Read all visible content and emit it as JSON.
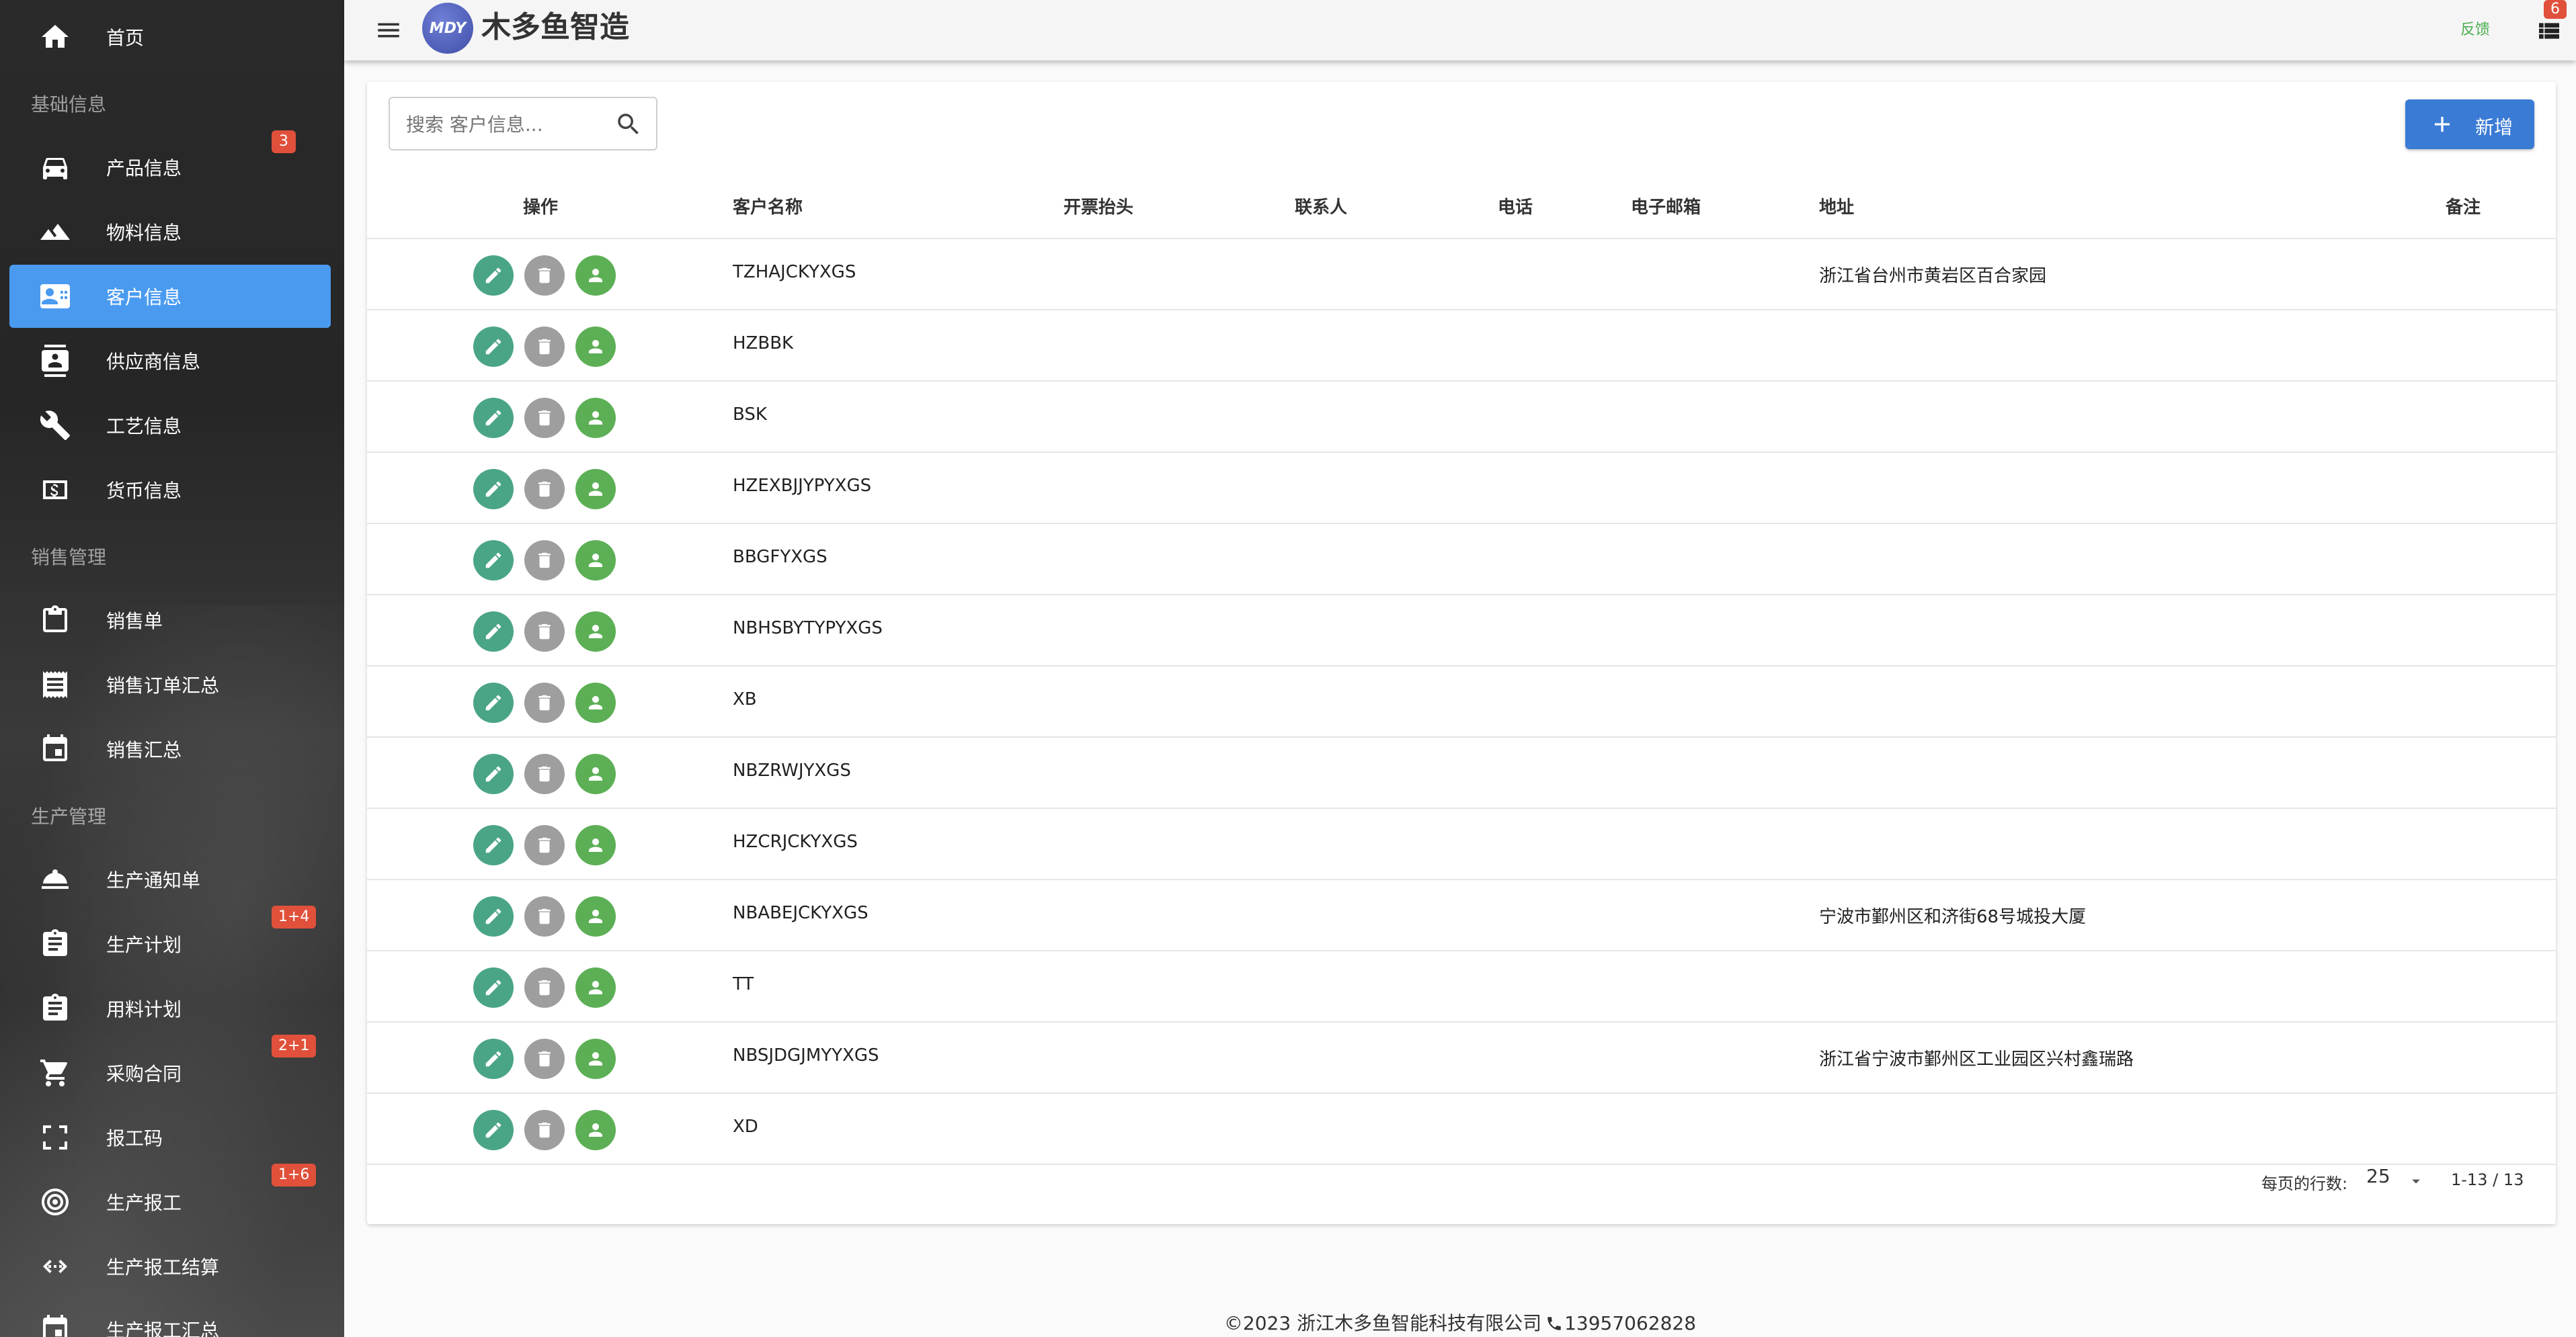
{
  "app": {
    "brand": "木多鱼智造",
    "logo_text": "MDY"
  },
  "header": {
    "feedback_label": "反馈",
    "notifications_count": "6"
  },
  "sidebar": {
    "home": "首页",
    "sections": {
      "basic": "基础信息",
      "sales": "销售管理",
      "production": "生产管理"
    },
    "items": {
      "product": "产品信息",
      "material": "物料信息",
      "customer": "客户信息",
      "supplier": "供应商信息",
      "process": "工艺信息",
      "currency": "货币信息",
      "sales_order": "销售单",
      "sales_order_summary": "销售订单汇总",
      "sales_summary": "销售汇总",
      "production_notice": "生产通知单",
      "production_plan": "生产计划",
      "material_plan": "用料计划",
      "purchase_contract": "采购合同",
      "work_code": "报工码",
      "production_report": "生产报工",
      "report_settlement": "生产报工结算",
      "report_summary": "生产报工汇总"
    },
    "badges": {
      "product": "3",
      "production_plan": "1+4",
      "purchase_contract": "2+1",
      "production_report": "1+6"
    }
  },
  "toolbar": {
    "search_placeholder": "搜索 客户信息...",
    "add_label": "新增"
  },
  "table": {
    "columns": {
      "actions": "操作",
      "name": "客户名称",
      "invoice": "开票抬头",
      "contact": "联系人",
      "phone": "电话",
      "email": "电子邮箱",
      "address": "地址",
      "remark": "备注"
    },
    "rows": [
      {
        "name": "TZHAJCKYXGS",
        "address": "浙江省台州市黄岩区百合家园"
      },
      {
        "name": "HZBBK",
        "address": ""
      },
      {
        "name": "BSK",
        "address": ""
      },
      {
        "name": "HZEXBJJYPYXGS",
        "address": ""
      },
      {
        "name": "BBGFYXGS",
        "address": ""
      },
      {
        "name": "NBHSBYTYPYXGS",
        "address": ""
      },
      {
        "name": "XB",
        "address": ""
      },
      {
        "name": "NBZRWJYXGS",
        "address": ""
      },
      {
        "name": "HZCRJCKYXGS",
        "address": ""
      },
      {
        "name": "NBABEJCKYXGS",
        "address": "宁波市鄞州区和济街68号城投大厦"
      },
      {
        "name": "TT",
        "address": ""
      },
      {
        "name": "NBSJDGJMYYXGS",
        "address": "浙江省宁波市鄞州区工业园区兴村鑫瑞路"
      },
      {
        "name": "XD",
        "address": ""
      }
    ]
  },
  "pagination": {
    "rows_per_page_label": "每页的行数:",
    "rows_per_page": "25",
    "range": "1-13 / 13"
  },
  "footer": {
    "copyright": "©2023 浙江木多鱼智能科技有限公司",
    "phone": "13957062828"
  },
  "colors": {
    "sidebar_active": "#4a9bf0",
    "primary": "#3a7bd5",
    "badge": "#e0503a",
    "edit": "#4aa586",
    "delete": "#9e9e9e",
    "user": "#5caf55",
    "feedback": "#4caf50"
  }
}
